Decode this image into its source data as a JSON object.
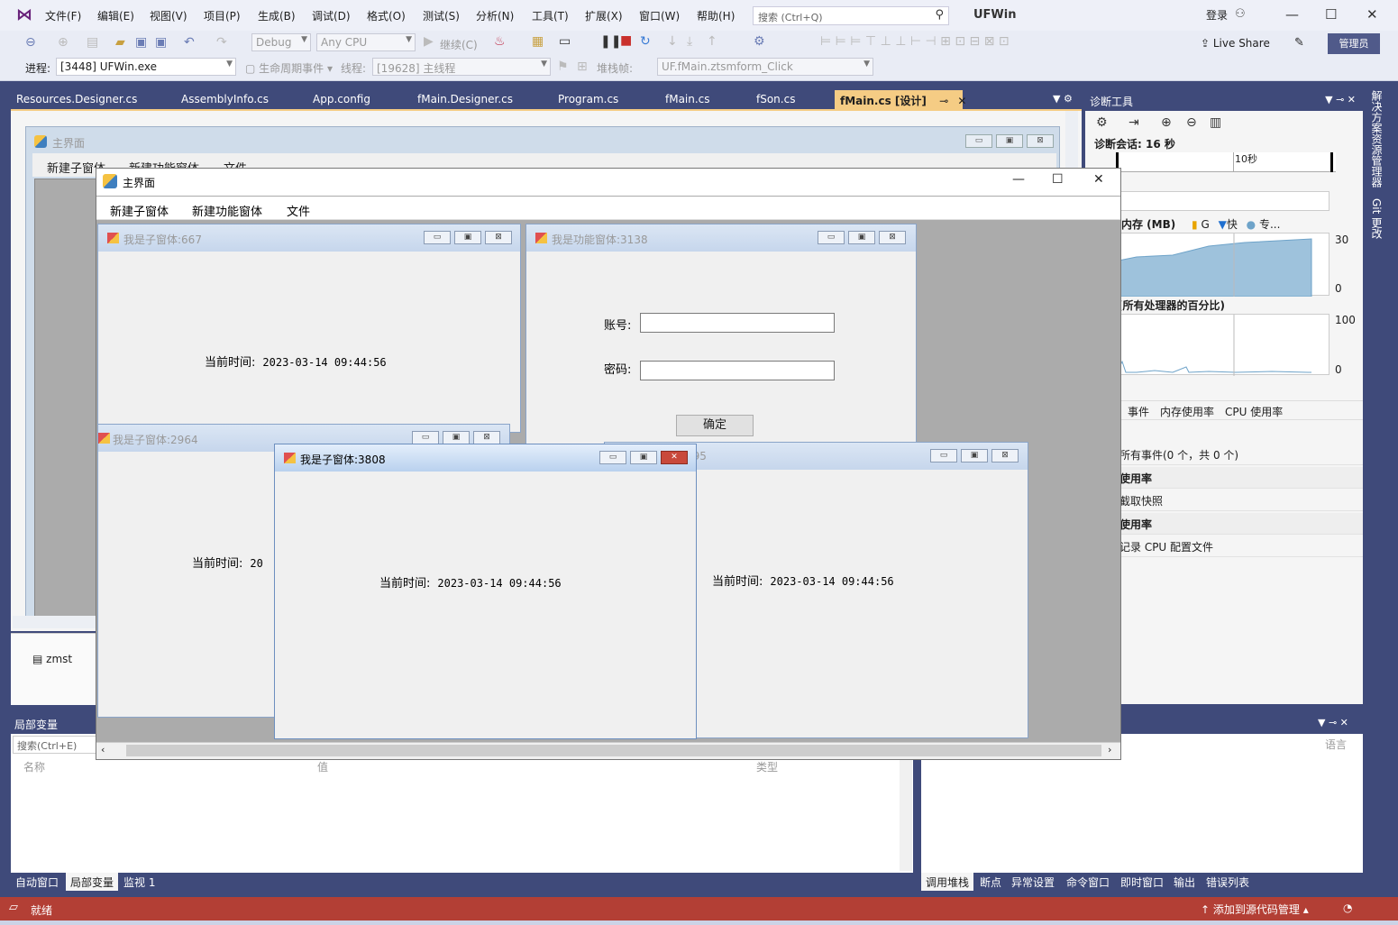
{
  "vs": {
    "menu": [
      "文件(F)",
      "编辑(E)",
      "视图(V)",
      "项目(P)",
      "生成(B)",
      "调试(D)",
      "格式(O)",
      "测试(S)",
      "分析(N)",
      "工具(T)",
      "扩展(X)",
      "窗口(W)",
      "帮助(H)"
    ],
    "search_placeholder": "搜索 (Ctrl+Q)",
    "app_name": "UFWin",
    "login": "登录",
    "toolbar": {
      "config": "Debug",
      "platform": "Any CPU",
      "continue": "继续(C)",
      "live_share": "Live Share",
      "admin": "管理员"
    },
    "toolbar2": {
      "process_label": "进程:",
      "process_value": "[3448] UFWin.exe",
      "lifecycle": "生命周期事件",
      "thread_label": "线程:",
      "thread_value": "[19628] 主线程",
      "stackframe_label": "堆栈帧:",
      "stackframe_value": "UF.fMain.ztsmform_Click"
    },
    "doc_tabs": [
      "Resources.Designer.cs",
      "AssemblyInfo.cs",
      "App.config",
      "fMain.Designer.cs",
      "Program.cs",
      "fMain.cs",
      "fSon.cs",
      "fMain.cs [设计]"
    ],
    "designer": {
      "form_title": "主界面",
      "menu": [
        "新建子窗体",
        "新建功能窗体",
        "文件"
      ],
      "tray_item": "zmst"
    },
    "diag": {
      "title": "诊断工具",
      "session": "诊断会话: 16 秒",
      "timeline_label": "10秒",
      "mem_title": "内存 (MB)",
      "mem_legend": [
        "G",
        "快",
        "专..."
      ],
      "mem_max": "30",
      "mem_min": "0",
      "cpu_title": "(所有处理器的百分比)",
      "cpu_max": "100",
      "cpu_min": "0",
      "tabs": [
        "事件",
        "内存使用率",
        "CPU 使用率"
      ],
      "rows": [
        "所有事件(0 个，共 0 个)",
        "使用率",
        "截取快照",
        "使用率",
        "记录 CPU 配置文件"
      ]
    },
    "side_tabs": [
      "解决方案资源管理器",
      "Git 更改"
    ],
    "locals": {
      "title": "局部变量",
      "search": "搜索(Ctrl+E)",
      "columns": [
        "名称",
        "值",
        "类型"
      ]
    },
    "bottom_tabs_left": [
      "自动窗口",
      "局部变量",
      "监视 1"
    ],
    "bottom_tabs_right": [
      "调用堆栈",
      "断点",
      "异常设置",
      "命令窗口",
      "即时窗口",
      "输出",
      "错误列表"
    ],
    "right_panel_col": "语言",
    "status": "就绪",
    "status_src": "添加到源代码管理"
  },
  "app": {
    "title": "主界面",
    "menu": [
      "新建子窗体",
      "新建功能窗体",
      "文件"
    ],
    "children": [
      {
        "title": "我是子窗体:667",
        "label": "当前时间:",
        "time": "2023-03-14 09:44:56"
      },
      {
        "title": "我是功能窗体:3138",
        "account": "账号:",
        "password": "密码:",
        "ok": "确定"
      },
      {
        "title": "我是子窗体:2964",
        "label": "当前时间:",
        "time": "20"
      },
      {
        "title": "我是子窗体:3808",
        "label": "当前时间:",
        "time": "2023-03-14 09:44:56"
      },
      {
        "title": "395",
        "label": "当前时间:",
        "time": "2023-03-14 09:44:56"
      }
    ]
  }
}
